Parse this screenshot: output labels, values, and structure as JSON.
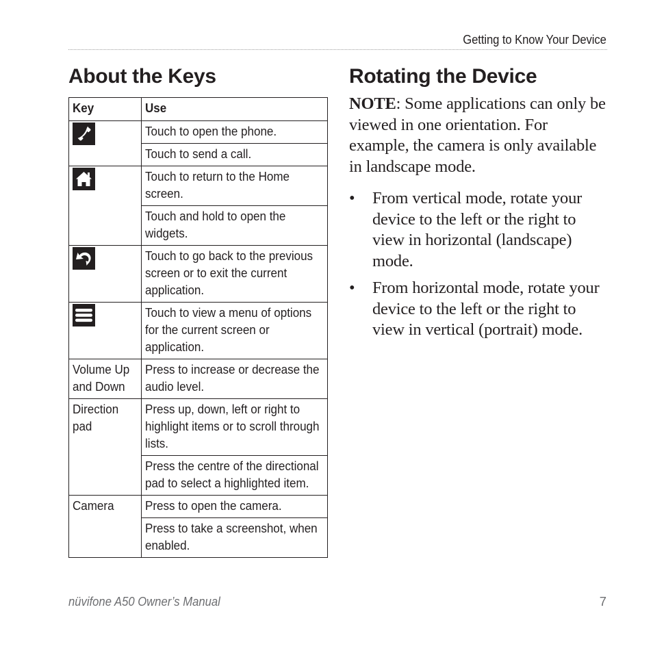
{
  "header": {
    "section_title": "Getting to Know Your Device"
  },
  "keys_section": {
    "title": "About the Keys",
    "table": {
      "columns": [
        "Key",
        "Use"
      ],
      "rows": [
        {
          "key": "",
          "key_icon": "phone-icon",
          "uses": [
            "Touch to open the phone.",
            "Touch to send a call."
          ]
        },
        {
          "key": "",
          "key_icon": "home-icon",
          "uses": [
            "Touch to return to the Home screen.",
            "Touch and hold to open the widgets."
          ]
        },
        {
          "key": "",
          "key_icon": "back-icon",
          "uses": [
            "Touch to go back to the previous screen or to exit the current application."
          ]
        },
        {
          "key": "",
          "key_icon": "menu-icon",
          "uses": [
            "Touch to view a menu of options for the current screen or application."
          ]
        },
        {
          "key": "Volume Up and Down",
          "key_icon": null,
          "uses": [
            "Press to increase or decrease the audio level."
          ]
        },
        {
          "key": "Direction pad",
          "key_icon": null,
          "uses": [
            "Press up, down, left or right to highlight items or to scroll through lists.",
            "Press the centre of the directional pad to select a highlighted item."
          ]
        },
        {
          "key": "Camera",
          "key_icon": null,
          "uses": [
            "Press to open the camera.",
            "Press to take a screenshot, when enabled."
          ]
        }
      ]
    }
  },
  "rotating_section": {
    "title": "Rotating the Device",
    "note_label": "NOTE",
    "note_text": ": Some applications can only be viewed in one orientation. For example, the camera is only available in landscape mode.",
    "bullet_glyph": "•",
    "bullets": [
      "From vertical mode, rotate your device to the left or the right to view in horizontal (landscape) mode.",
      "From horizontal mode, rotate your device to the left or the right to view in vertical (portrait) mode."
    ]
  },
  "footer": {
    "manual_title": "nüvifone A50 Owner’s Manual",
    "page_number": "7"
  }
}
